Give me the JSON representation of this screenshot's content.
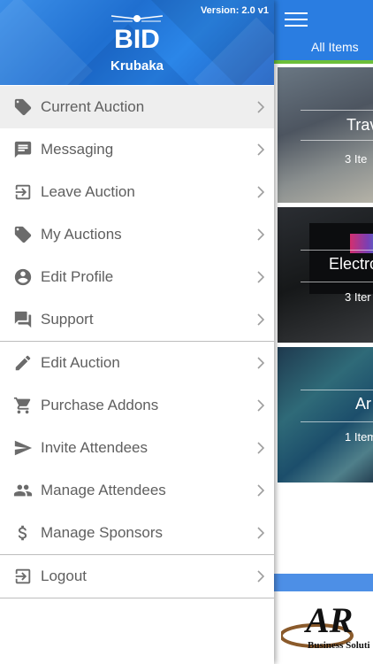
{
  "drawer": {
    "version": "Version: 2.0 v1",
    "logo_text": "BID",
    "app_name": "Krubaka",
    "items": [
      {
        "label": "Current Auction",
        "icon": "tag-icon",
        "active": true
      },
      {
        "label": "Messaging",
        "icon": "chat-icon"
      },
      {
        "label": "Leave Auction",
        "icon": "exit-icon"
      },
      {
        "label": "My Auctions",
        "icon": "tags-icon"
      },
      {
        "label": "Edit Profile",
        "icon": "account-circle-icon"
      },
      {
        "label": "Support",
        "icon": "forum-icon"
      },
      {
        "label": "Edit Auction",
        "icon": "pencil-icon"
      },
      {
        "label": "Purchase Addons",
        "icon": "cart-icon"
      },
      {
        "label": "Invite Attendees",
        "icon": "send-icon"
      },
      {
        "label": "Manage Attendees",
        "icon": "people-icon"
      },
      {
        "label": "Manage Sponsors",
        "icon": "dollar-icon"
      },
      {
        "label": "Logout",
        "icon": "logout-icon"
      }
    ]
  },
  "background": {
    "title": "All Items",
    "cards": [
      {
        "label": "Trav",
        "count": "3 Ite"
      },
      {
        "label": "Electro",
        "count": "3 Iter"
      },
      {
        "label": "Ar",
        "count": "1 Item"
      }
    ],
    "sponsor_text": "AR",
    "sponsor_sub": "Business Soluti"
  },
  "colors": {
    "header_blue": "#2a7de1",
    "accent_green": "#6cbf3a",
    "menu_text": "#5f5f5f",
    "active_bg": "#eeeeee"
  }
}
